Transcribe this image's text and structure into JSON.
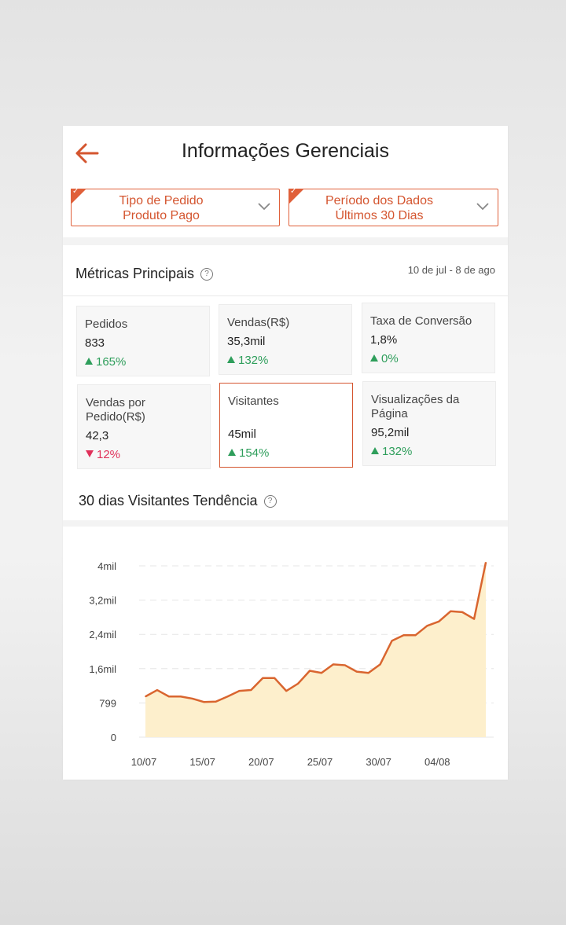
{
  "header": {
    "title": "Informações Gerenciais",
    "back_icon": "back-arrow-icon"
  },
  "filters": [
    {
      "line1": "Tipo de Pedido",
      "line2": "Produto Pago"
    },
    {
      "line1": "Período dos Dados",
      "line2": "Últimos 30 Dias"
    }
  ],
  "metrics": {
    "title": "Métricas Principais",
    "date_range": "10 de jul - 8 de ago",
    "tiles": [
      {
        "label": "Pedidos",
        "value": "833",
        "change": "165%",
        "direction": "up"
      },
      {
        "label": "Vendas(R$)",
        "value": "35,3mil",
        "change": "132%",
        "direction": "up"
      },
      {
        "label": "Taxa de Conversão",
        "value": "1,8%",
        "change": "0%",
        "direction": "up"
      },
      {
        "label": "Vendas por Pedido(R$)",
        "value": "42,3",
        "change": "12%",
        "direction": "down"
      },
      {
        "label": "Visitantes",
        "value": "45mil",
        "change": "154%",
        "direction": "up"
      },
      {
        "label": "Visualizações da Página",
        "value": "95,2mil",
        "change": "132%",
        "direction": "up"
      }
    ]
  },
  "trend": {
    "title": "30 dias Visitantes Tendência"
  },
  "colors": {
    "accent": "#d4552f",
    "up": "#2e9e5b",
    "down": "#e0305a",
    "area_fill": "#fdefcc",
    "line": "#d9652f"
  },
  "chart_data": {
    "type": "area",
    "title": "30 dias Visitantes Tendência",
    "y_ticks": [
      "0",
      "799",
      "1,6mil",
      "2,4mil",
      "3,2mil",
      "4mil"
    ],
    "y_tick_values": [
      0,
      799,
      1600,
      2400,
      3200,
      4000
    ],
    "x_ticks": [
      "10/07",
      "15/07",
      "20/07",
      "25/07",
      "30/07",
      "04/08"
    ],
    "x_tick_index": [
      0,
      5,
      10,
      15,
      20,
      25
    ],
    "ylim": [
      0,
      4000
    ],
    "grid": true,
    "series": [
      {
        "values": [
          950,
          1100,
          950,
          950,
          900,
          820,
          830,
          950,
          1080,
          1100,
          1380,
          1380,
          1080,
          1250,
          1550,
          1500,
          1700,
          1680,
          1530,
          1500,
          1700,
          2250,
          2380,
          2380,
          2600,
          2700,
          2940,
          2920,
          2760,
          4080
        ]
      }
    ]
  }
}
